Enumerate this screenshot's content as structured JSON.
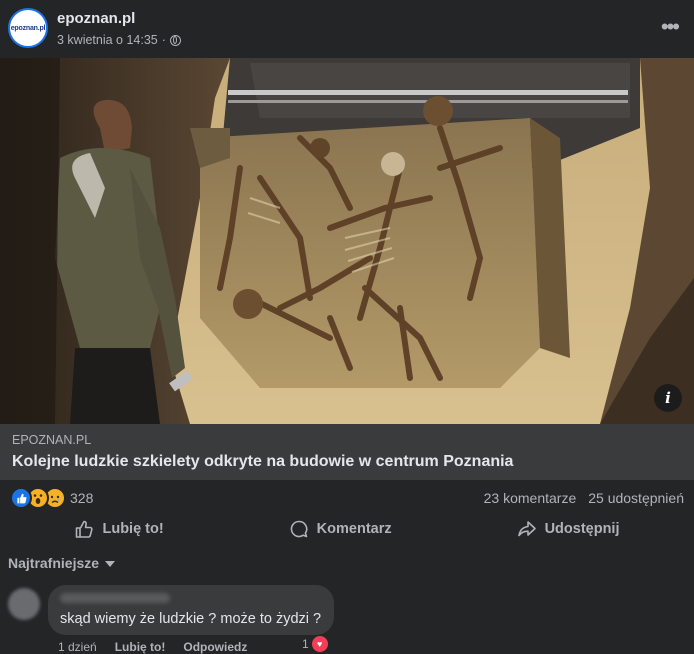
{
  "post": {
    "page_name": "epoznan.pl",
    "avatar_logo": "epoznan.pl",
    "date": "3 kwietnia o 14:35",
    "meta_separator": "·",
    "privacy_icon": "globe-icon",
    "more_icon": "•••"
  },
  "link_preview": {
    "domain": "EPOZNAN.PL",
    "title": "Kolejne ludzkie szkielety odkryte na budowie w centrum Poznania",
    "info_icon": "i"
  },
  "stats": {
    "reaction_icons": [
      "like-icon",
      "wow-icon",
      "sad-icon"
    ],
    "reaction_count": "328",
    "comments": "23 komentarze",
    "shares": "25 udostępnień"
  },
  "actions": {
    "like": "Lubię to!",
    "comment": "Komentarz",
    "share": "Udostępnij"
  },
  "comments": {
    "sort_label": "Najtrafniejsze",
    "items": [
      {
        "text": "skąd wiemy że ludzkie ? może to żydzi ?",
        "time": "1 dzień",
        "like": "Lubię to!",
        "reply": "Odpowiedz",
        "reaction_count": "1"
      }
    ]
  },
  "colors": {
    "background": "#242526",
    "surface": "#3a3b3c",
    "text_primary": "#e4e6eb",
    "text_secondary": "#b0b3b8",
    "accent": "#1b74e4",
    "love": "#f33e58"
  }
}
